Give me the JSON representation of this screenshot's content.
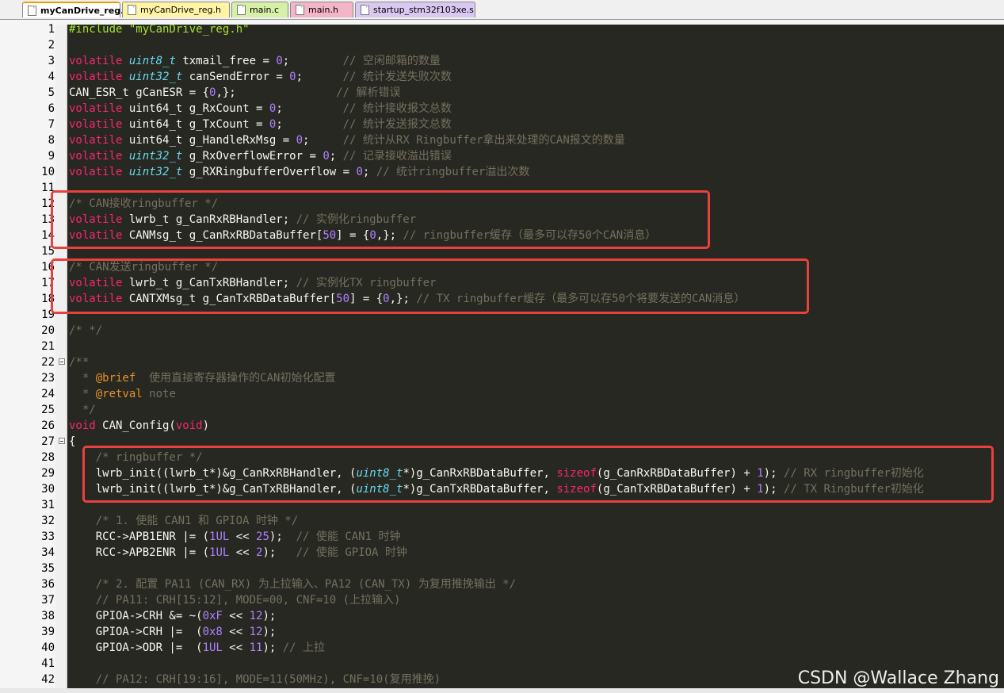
{
  "tabs": [
    {
      "label": "myCanDrive_reg.c",
      "color": "#ffffff",
      "active": true
    },
    {
      "label": "myCanDrive_reg.h",
      "color": "#fff3a6"
    },
    {
      "label": "main.c",
      "color": "#d6f0a8"
    },
    {
      "label": "main.h",
      "color": "#f5b5c8"
    },
    {
      "label": "startup_stm32f103xe.s",
      "color": "#d9c8f0"
    }
  ],
  "lines": [
    {
      "n": "1",
      "html": "<span class=\"pp\">#include \"myCanDrive_reg.h\"</span>"
    },
    {
      "n": "2",
      "html": ""
    },
    {
      "n": "3",
      "html": "<span class=\"kw\">volatile</span> <span class=\"ty\">uint8_t</span> txmail_free = <span class=\"num\">0</span>;        <span class=\"cm\">// 空闲邮箱的数量</span>"
    },
    {
      "n": "4",
      "html": "<span class=\"kw\">volatile</span> <span class=\"ty\">uint32_t</span> canSendError = <span class=\"num\">0</span>;      <span class=\"cm\">// 统计发送失败次数</span>"
    },
    {
      "n": "5",
      "html": "CAN_ESR_t gCanESR = {<span class=\"num\">0</span>,};               <span class=\"cm\">// 解析错误</span>"
    },
    {
      "n": "6",
      "html": "<span class=\"kw\">volatile</span> uint64_t g_RxCount = <span class=\"num\">0</span>;         <span class=\"cm\">// 统计接收报文总数</span>"
    },
    {
      "n": "7",
      "html": "<span class=\"kw\">volatile</span> uint64_t g_TxCount = <span class=\"num\">0</span>;         <span class=\"cm\">// 统计发送报文总数</span>"
    },
    {
      "n": "8",
      "html": "<span class=\"kw\">volatile</span> uint64_t g_HandleRxMsg = <span class=\"num\">0</span>;     <span class=\"cm\">// 统计从RX Ringbuffer拿出来处理的CAN报文的数量</span>"
    },
    {
      "n": "9",
      "html": "<span class=\"kw\">volatile</span> <span class=\"ty\">uint32_t</span> g_RxOverflowError = <span class=\"num\">0</span>; <span class=\"cm\">// 记录接收溢出错误</span>"
    },
    {
      "n": "10",
      "html": "<span class=\"kw\">volatile</span> <span class=\"ty\">uint32_t</span> g_RXRingbufferOverflow = <span class=\"num\">0</span>; <span class=\"cm\">// 统计ringbuffer溢出次数</span>"
    },
    {
      "n": "11",
      "html": ""
    },
    {
      "n": "12",
      "html": "<span class=\"cm\">/* CAN接收ringbuffer */</span>"
    },
    {
      "n": "13",
      "html": "<span class=\"kw\">volatile</span> lwrb_t g_CanRxRBHandler; <span class=\"cm\">// 实例化ringbuffer</span>"
    },
    {
      "n": "14",
      "html": "<span class=\"kw\">volatile</span> CANMsg_t g_CanRxRBDataBuffer[<span class=\"num\">50</span>] = {<span class=\"num\">0</span>,}; <span class=\"cm\">// ringbuffer缓存（最多可以存50个CAN消息）</span>"
    },
    {
      "n": "15",
      "html": ""
    },
    {
      "n": "16",
      "html": "<span class=\"cm\">/* CAN发送ringbuffer */</span>"
    },
    {
      "n": "17",
      "html": "<span class=\"kw\">volatile</span> lwrb_t g_CanTxRBHandler; <span class=\"cm\">// 实例化TX ringbuffer</span>"
    },
    {
      "n": "18",
      "html": "<span class=\"kw\">volatile</span> CANTXMsg_t g_CanTxRBDataBuffer[<span class=\"num\">50</span>] = {<span class=\"num\">0</span>,}; <span class=\"cm\">// TX ringbuffer缓存（最多可以存50个将要发送的CAN消息）</span>"
    },
    {
      "n": "19",
      "html": ""
    },
    {
      "n": "20",
      "html": "<span class=\"cm\">/* */</span>"
    },
    {
      "n": "21",
      "html": ""
    },
    {
      "n": "22",
      "html": "<span class=\"cm\">/**</span>",
      "fold": true
    },
    {
      "n": "23",
      "html": "<span class=\"cm\">  * <span class=\"doc\">@brief</span>  使用直接寄存器操作的CAN初始化配置</span>"
    },
    {
      "n": "24",
      "html": "<span class=\"cm\">  * <span class=\"doc\">@retval</span> note</span>"
    },
    {
      "n": "25",
      "html": "<span class=\"cm\">  */</span>"
    },
    {
      "n": "26",
      "html": "<span class=\"kw\">void</span> CAN_Config(<span class=\"kw\">void</span>)"
    },
    {
      "n": "27",
      "html": "{",
      "fold": true
    },
    {
      "n": "28",
      "html": "    <span class=\"cm\">/* ringbuffer */</span>"
    },
    {
      "n": "29",
      "html": "    lwrb_init((lwrb_t*)&amp;g_CanRxRBHandler, (<span class=\"ty\">uint8_t</span>*)g_CanRxRBDataBuffer, <span class=\"kw\">sizeof</span>(g_CanRxRBDataBuffer) + <span class=\"num\">1</span>); <span class=\"cm\">// RX ringbuffer初始化</span>"
    },
    {
      "n": "30",
      "html": "    lwrb_init((lwrb_t*)&amp;g_CanTxRBHandler, (<span class=\"ty\">uint8_t</span>*)g_CanTxRBDataBuffer, <span class=\"kw\">sizeof</span>(g_CanTxRBDataBuffer) + <span class=\"num\">1</span>); <span class=\"cm\">// TX Ringbuffer初始化</span>"
    },
    {
      "n": "31",
      "html": ""
    },
    {
      "n": "32",
      "html": "    <span class=\"cm\">/* 1. 使能 CAN1 和 GPIOA 时钟 */</span>"
    },
    {
      "n": "33",
      "html": "    RCC-&gt;APB1ENR |= (<span class=\"num\">1UL</span> &lt;&lt; <span class=\"num\">25</span>);  <span class=\"cm\">// 使能 CAN1 时钟</span>"
    },
    {
      "n": "34",
      "html": "    RCC-&gt;APB2ENR |= (<span class=\"num\">1UL</span> &lt;&lt; <span class=\"num\">2</span>);   <span class=\"cm\">// 使能 GPIOA 时钟</span>"
    },
    {
      "n": "35",
      "html": ""
    },
    {
      "n": "36",
      "html": "    <span class=\"cm\">/* 2. 配置 PA11 (CAN_RX) 为上拉输入、PA12 (CAN_TX) 为复用推挽输出 */</span>"
    },
    {
      "n": "37",
      "html": "    <span class=\"cm\">// PA11: CRH[15:12], MODE=00, CNF=10 (上拉输入)</span>"
    },
    {
      "n": "38",
      "html": "    GPIOA-&gt;CRH &amp;= ~(<span class=\"num\">0xF</span> &lt;&lt; <span class=\"num\">12</span>);"
    },
    {
      "n": "39",
      "html": "    GPIOA-&gt;CRH |=  (<span class=\"num\">0x8</span> &lt;&lt; <span class=\"num\">12</span>);"
    },
    {
      "n": "40",
      "html": "    GPIOA-&gt;ODR |=  (<span class=\"num\">1UL</span> &lt;&lt; <span class=\"num\">11</span>); <span class=\"cm\">// 上拉</span>"
    },
    {
      "n": "41",
      "html": ""
    },
    {
      "n": "42",
      "html": "    <span class=\"cm\">// PA12: CRH[19:16], MODE=11(50MHz), CNF=10(复用推挽)</span>"
    }
  ],
  "watermark": "CSDN @Wallace Zhang",
  "highlight_box_color": "#e8413e"
}
